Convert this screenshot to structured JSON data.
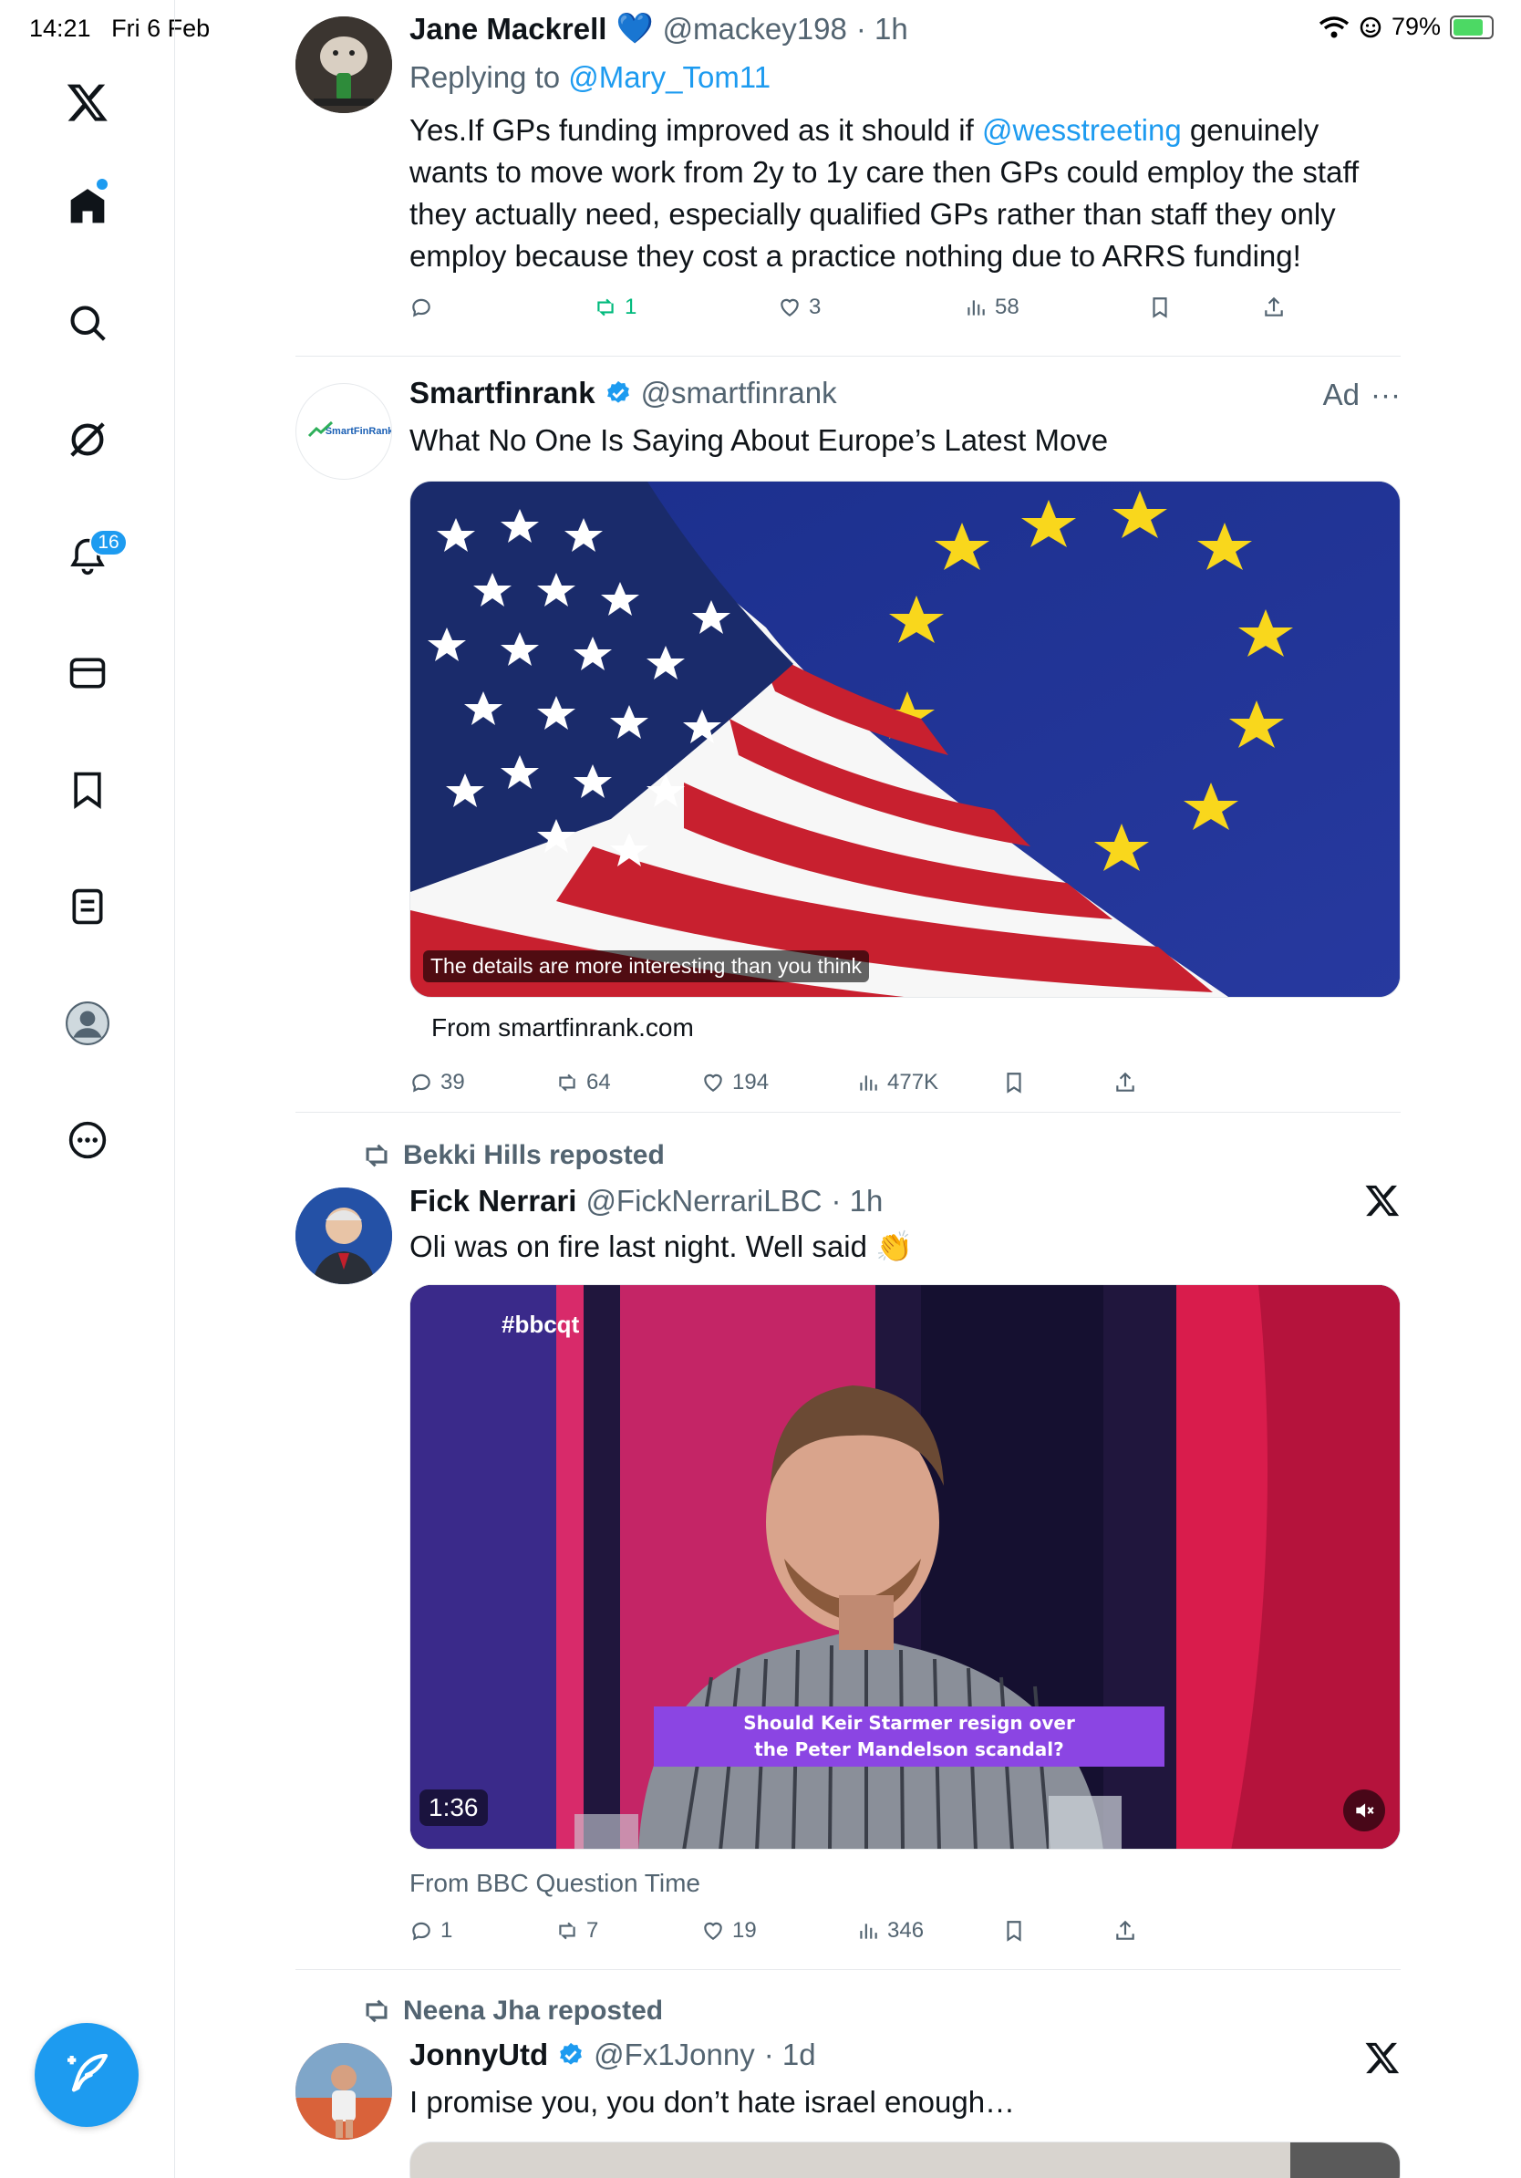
{
  "status_bar": {
    "time": "14:21",
    "date": "Fri 6 Feb",
    "battery": "79%",
    "battery_level": 0.79
  },
  "sidebar": {
    "items": [
      {
        "icon": "x-logo-icon"
      },
      {
        "icon": "home-icon"
      },
      {
        "icon": "search-icon"
      },
      {
        "icon": "grok-icon"
      },
      {
        "icon": "bell-icon",
        "badge": "16"
      },
      {
        "icon": "mail-icon"
      },
      {
        "icon": "bookmark-icon"
      },
      {
        "icon": "list-icon"
      },
      {
        "icon": "profile-icon"
      },
      {
        "icon": "more-icon"
      }
    ],
    "compose_icon": "compose-icon"
  },
  "colors": {
    "accent": "#1d9bf0",
    "retweet_green": "#00ba7c",
    "text": "#0f1419",
    "muted": "#536471"
  },
  "tweets": [
    {
      "name": "Jane Mackrell",
      "name_emoji": "💙",
      "handle": "@mackey198",
      "time": "· 1h",
      "replying_prefix": "Replying to",
      "replying_to": "@Mary_Tom11",
      "text_1": "Yes.If GPs funding improved as it should if",
      "mention": "@wesstreeting",
      "text_2": "genuinely",
      "text_3": "wants to move work from 2y to 1y care then GPs could employ the staff",
      "text_4": "they actually need, especially qualified GPs rather than staff they only",
      "text_5": "employ because they cost a practice nothing due to ARRS funding!",
      "replies": "",
      "reposts": "1",
      "likes": "3",
      "views": "58"
    },
    {
      "name": "Smartfinrank",
      "handle": "@smartfinrank",
      "ad_label": "Ad",
      "more": "···",
      "text": "What No One Is Saying About Europe’s Latest Move",
      "avatar_text": "SmartFinRank",
      "media_caption": "The details are more interesting than you think",
      "source": "From smartfinrank.com",
      "replies": "39",
      "reposts": "64",
      "likes": "194",
      "views": "477K"
    },
    {
      "reposted_by": "Bekki Hills reposted",
      "name": "Fick Nerrari",
      "handle": "@FickNerrariLBC",
      "time": "· 1h",
      "text": "Oli was on fire last night. Well said",
      "text_emoji": "👏",
      "video_tag": "#bbcqt",
      "video_caption_1": "Should Keir Starmer resign over",
      "video_caption_2": "the Peter Mandelson scandal?",
      "duration": "1:36",
      "source": "From BBC Question Time",
      "replies": "1",
      "reposts": "7",
      "likes": "19",
      "views": "346"
    },
    {
      "reposted_by": "Neena Jha reposted",
      "name": "JonnyUtd",
      "handle": "@Fx1Jonny",
      "time": "· 1d",
      "text": "I promise you, you don’t hate israel enough…"
    }
  ]
}
